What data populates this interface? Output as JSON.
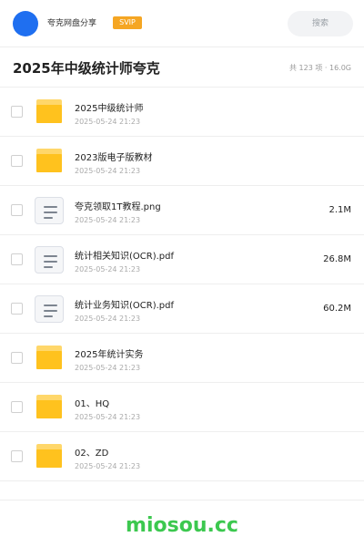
{
  "header": {
    "share_name": "夸克网盘分享",
    "badge": "SVIP",
    "search_label": "搜索",
    "accent_color": "#1f6ff0",
    "badge_color": "#f5a623"
  },
  "folder": {
    "title": "2025年中级统计师夸克",
    "summary": "共 123 项 · 16.0G"
  },
  "files": [
    {
      "type": "folder",
      "icon": "folder-icon",
      "name": "2025中级统计师",
      "date": "2025-05-24 21:23",
      "size": ""
    },
    {
      "type": "folder",
      "icon": "folder-icon",
      "name": "2023版电子版教材",
      "date": "2025-05-24 21:23",
      "size": ""
    },
    {
      "type": "file",
      "icon": "file-icon",
      "name": "夸克领取1T教程.png",
      "date": "2025-05-24 21:23",
      "size": "2.1M"
    },
    {
      "type": "file",
      "icon": "file-icon",
      "name": "统计相关知识(OCR).pdf",
      "date": "2025-05-24 21:23",
      "size": "26.8M"
    },
    {
      "type": "file",
      "icon": "file-icon",
      "name": "统计业务知识(OCR).pdf",
      "date": "2025-05-24 21:23",
      "size": "60.2M"
    },
    {
      "type": "folder",
      "icon": "folder-icon",
      "name": "2025年统计实务",
      "date": "2025-05-24 21:23",
      "size": ""
    },
    {
      "type": "folder",
      "icon": "folder-icon",
      "name": "01、HQ",
      "date": "2025-05-24 21:23",
      "size": ""
    },
    {
      "type": "folder",
      "icon": "folder-icon",
      "name": "02、ZD",
      "date": "2025-05-24 21:23",
      "size": ""
    }
  ],
  "footer": {
    "brand": "miosou.cc",
    "brand_color": "#3cc84f"
  }
}
